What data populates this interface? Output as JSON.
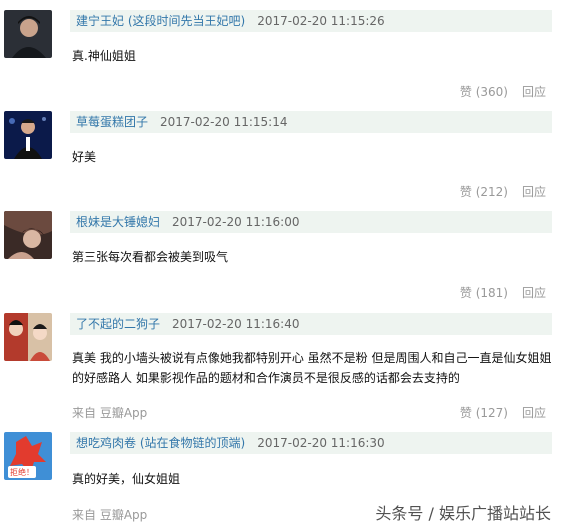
{
  "comments": [
    {
      "author": "建宁王妃",
      "author_note": "(这段时间先当王妃吧)",
      "time": "2017-02-20 11:15:26",
      "text": "真.神仙姐姐",
      "source_prefix": "",
      "source_app": "",
      "likes": "赞 (360)",
      "reply": "回应"
    },
    {
      "author": "草莓蛋糕团子",
      "author_note": "",
      "time": "2017-02-20 11:15:14",
      "text": "好美",
      "source_prefix": "",
      "source_app": "",
      "likes": "赞 (212)",
      "reply": "回应"
    },
    {
      "author": "根妹是大锤媳妇",
      "author_note": "",
      "time": "2017-02-20 11:16:00",
      "text": "第三张每次看都会被美到吸气",
      "source_prefix": "",
      "source_app": "",
      "likes": "赞 (181)",
      "reply": "回应"
    },
    {
      "author": "了不起的二狗子",
      "author_note": "",
      "time": "2017-02-20 11:16:40",
      "text": "真美 我的小墙头被说有点像她我都特别开心 虽然不是粉 但是周围人和自己一直是仙女姐姐的好感路人 如果影视作品的题材和合作演员不是很反感的话都会去支持的",
      "source_prefix": "来自",
      "source_app": "豆瓣App",
      "likes": "赞 (127)",
      "reply": "回应"
    },
    {
      "author": "想吃鸡肉卷",
      "author_note": "(站在食物链的顶端)",
      "time": "2017-02-20 11:16:30",
      "text": "真的好美，仙女姐姐",
      "source_prefix": "来自",
      "source_app": "豆瓣App",
      "likes": "",
      "reply": ""
    }
  ],
  "avatar5_badge": "拒绝！",
  "watermark": "头条号 / 娱乐广播站站长"
}
